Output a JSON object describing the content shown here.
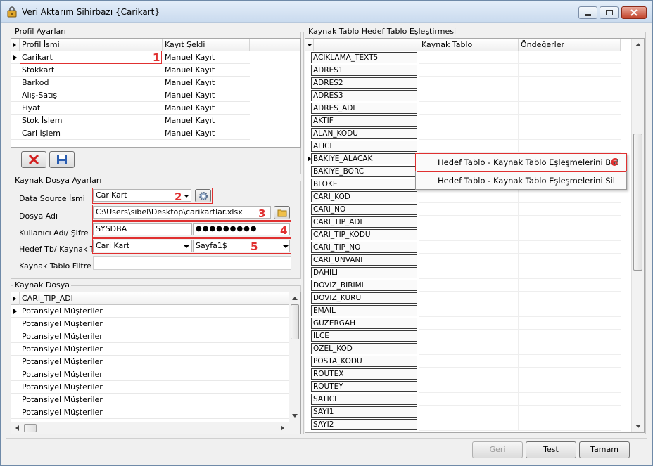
{
  "window": {
    "title": "Veri Aktarım Sihirbazı {Carikart}"
  },
  "profile_group": {
    "title": "Profil Ayarları",
    "columns": [
      "Profil İsmi",
      "Kayıt Şekli"
    ],
    "rows": [
      {
        "name": "Carikart",
        "mode": "Manuel Kayıt"
      },
      {
        "name": "Stokkart",
        "mode": "Manuel Kayıt"
      },
      {
        "name": "Barkod",
        "mode": "Manuel Kayıt"
      },
      {
        "name": "Alış-Satış",
        "mode": "Manuel Kayıt"
      },
      {
        "name": "Fiyat",
        "mode": "Manuel Kayıt"
      },
      {
        "name": "Stok İşlem",
        "mode": "Manuel Kayıt"
      },
      {
        "name": "Cari İşlem",
        "mode": "Manuel Kayıt"
      }
    ],
    "delete_icon": "red-x-icon",
    "save_icon": "floppy-disk-icon"
  },
  "source_group": {
    "title": "Kaynak Dosya Ayarları",
    "datasource_label": "Data Source İsmi",
    "datasource_value": "CariKart",
    "file_label": "Dosya Adı",
    "file_value": "C:\\Users\\sibel\\Desktop\\carikartlar.xlsx",
    "user_label": "Kullanıcı Adı/ Şifre",
    "user_value": "SYSDBA",
    "password_value": "●●●●●●●●●",
    "target_label": "Hedef Tb/ Kaynak Tb",
    "target_value": "Cari Kart",
    "sheet_value": "Sayfa1$",
    "filter_label": "Kaynak Tablo Filtre",
    "filter_value": ""
  },
  "source_file_group": {
    "title": "Kaynak Dosya",
    "column": "CARI_TIP_ADI",
    "rows": [
      "Potansiyel Müşteriler",
      "Potansiyel Müşteriler",
      "Potansiyel Müşteriler",
      "Potansiyel Müşteriler",
      "Potansiyel Müşteriler",
      "Potansiyel Müşteriler",
      "Potansiyel Müşteriler",
      "Potansiyel Müşteriler",
      "Potansiyel Müşteriler"
    ]
  },
  "mapping_group": {
    "title": "Kaynak Tablo  Hedef Tablo Eşleştirmesi",
    "columns": [
      "",
      "Kaynak Tablo",
      "Öndeğerler"
    ],
    "fields": [
      "ACIKLAMA_TEXT5",
      "ADRES1",
      "ADRES2",
      "ADRES3",
      "ADRES_ADI",
      "AKTIF",
      "ALAN_KODU",
      "ALICI",
      "BAKIYE_ALACAK",
      "BAKIYE_BORC",
      "BLOKE",
      "CARI_KOD",
      "CARI_NO",
      "CARI_TIP_ADI",
      "CARI_TIP_KODU",
      "CARI_TIP_NO",
      "CARI_UNVANI",
      "DAHILI",
      "DOVIZ_BIRIMI",
      "DOVIZ_KURU",
      "EMAIL",
      "GUZERGAH",
      "ILCE",
      "OZEL_KOD",
      "POSTA_KODU",
      "ROUTEX",
      "ROUTEY",
      "SATICI",
      "SAYI1",
      "SAYI2"
    ]
  },
  "context_menu": {
    "item1": "Hedef Tablo - Kaynak Tablo Eşleşmelerini Bul",
    "item2": "Hedef Tablo - Kaynak Tablo Eşleşmelerini Sil"
  },
  "annotations": {
    "n1": "1",
    "n2": "2",
    "n3": "3",
    "n4": "4",
    "n5": "5",
    "n6": "6"
  },
  "footer": {
    "back": "Geri",
    "test": "Test",
    "finish": "Tamam"
  },
  "colors": {
    "accent_red": "#e03030",
    "title_bar": "#c9daee"
  }
}
